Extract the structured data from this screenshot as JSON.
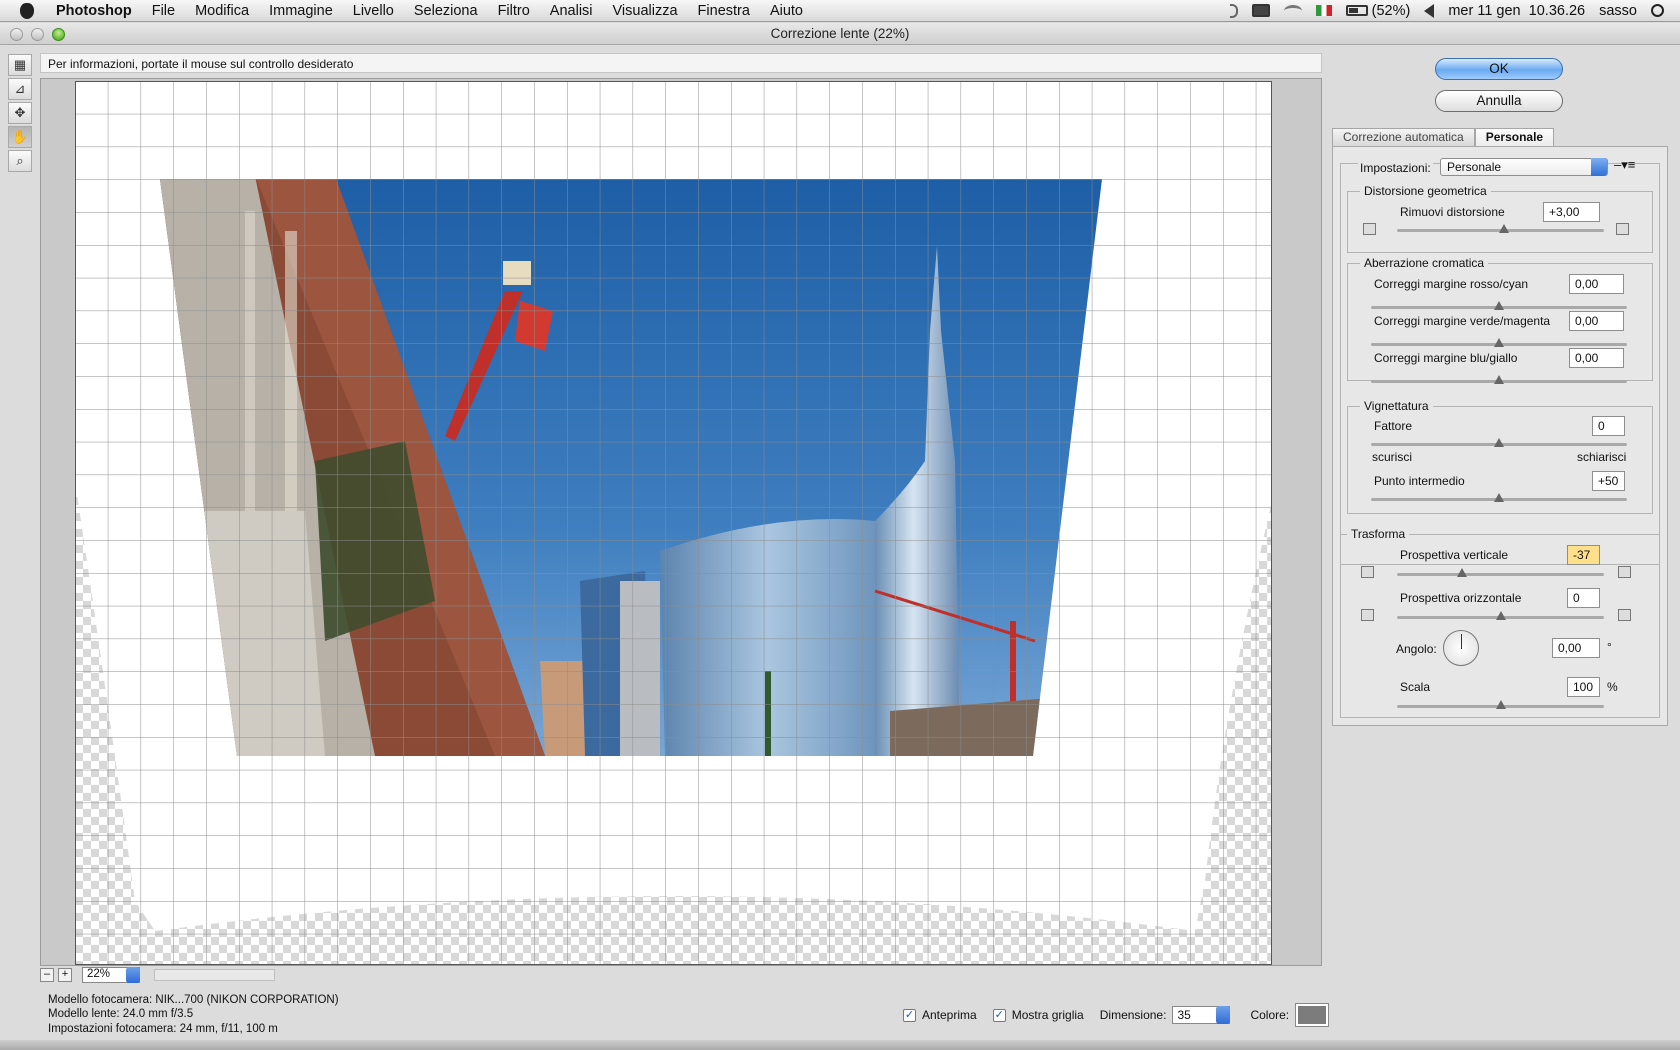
{
  "menubar": {
    "app": "Photoshop",
    "items": [
      "File",
      "Modifica",
      "Immagine",
      "Livello",
      "Seleziona",
      "Filtro",
      "Analisi",
      "Visualizza",
      "Finestra",
      "Aiuto"
    ],
    "battery": "(52%)",
    "clock": "mer 11 gen  10.36.26",
    "user": "sasso",
    "icons": [
      "apple-icon",
      "bluetooth-icon",
      "display-icon",
      "wifi-icon",
      "flag-icon",
      "battery-icon",
      "volume-icon",
      "spotlight-icon"
    ]
  },
  "window": {
    "title": "Correzione lente (22%)"
  },
  "info_text": "Per informazioni, portate il mouse sul controllo desiderato",
  "tools": [
    "remove-distortion-tool",
    "straighten-tool",
    "move-grid-tool",
    "hand-tool",
    "zoom-tool"
  ],
  "zoom": {
    "minus": "–",
    "plus": "+",
    "value": "22%"
  },
  "camera_info": {
    "model": "Modello fotocamera: NIK...700 (NIKON CORPORATION)",
    "lens": "Modello lente: 24.0 mm f/3.5",
    "settings": "Impostazioni fotocamera: 24 mm, f/11, 100 m"
  },
  "bottom": {
    "preview_label": "Anteprima",
    "grid_label": "Mostra griglia",
    "size_label": "Dimensione:",
    "size_value": "35",
    "color_label": "Colore:",
    "grid_color": "#7c7c7c"
  },
  "buttons": {
    "ok": "OK",
    "cancel": "Annulla"
  },
  "tabs": [
    "Correzione automatica",
    "Personale"
  ],
  "panel": {
    "settings_label": "Impostazioni:",
    "settings_value": "Personale",
    "distortion": {
      "title": "Distorsione geometrica",
      "label": "Rimuovi distorsione",
      "value": "+3,00",
      "level": 0.515
    },
    "chromatic": {
      "title": "Aberrazione cromatica",
      "rows": [
        {
          "label": "Correggi margine rosso/cyan",
          "value": "0,00",
          "level": 0.5
        },
        {
          "label": "Correggi margine verde/magenta",
          "value": "0,00",
          "level": 0.5
        },
        {
          "label": "Correggi margine blu/giallo",
          "value": "0,00",
          "level": 0.5
        }
      ]
    },
    "vignette": {
      "title": "Vignettatura",
      "amount_label": "Fattore",
      "amount_value": "0",
      "amount_level": 0.5,
      "darken": "scurisci",
      "lighten": "schiarisci",
      "mid_label": "Punto intermedio",
      "mid_value": "+50",
      "mid_level": 0.5
    },
    "transform": {
      "title": "Trasforma",
      "vert_label": "Prospettiva verticale",
      "vert_value": "-37",
      "vert_level": 0.315,
      "horiz_label": "Prospettiva orizzontale",
      "horiz_value": "0",
      "horiz_level": 0.5,
      "angle_label": "Angolo:",
      "angle_value": "0,00",
      "angle_unit": "°",
      "scale_label": "Scala",
      "scale_value": "100",
      "scale_unit": "%",
      "scale_level": 0.5
    }
  }
}
